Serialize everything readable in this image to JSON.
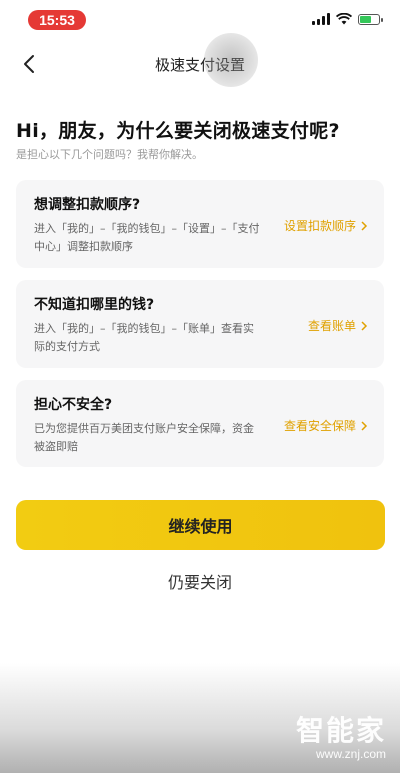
{
  "status_bar": {
    "time": "15:53",
    "battery_level_fraction": 0.55
  },
  "nav": {
    "title": "极速支付设置"
  },
  "headline": "Hi，朋友，为什么要关闭极速支付呢?",
  "subheadline": "是担心以下几个问题吗？我帮你解决。",
  "cards": [
    {
      "title": "想调整扣款顺序?",
      "desc": "进入「我的」–「我的钱包」–「设置」–「支付中心」调整扣款顺序",
      "link": "设置扣款顺序"
    },
    {
      "title": "不知道扣哪里的钱?",
      "desc": "进入「我的」–「我的钱包」–「账单」查看实际的支付方式",
      "link": "查看账单"
    },
    {
      "title": "担心不安全?",
      "desc": "已为您提供百万美团支付账户安全保障，资金被盗即赔",
      "link": "查看安全保障"
    }
  ],
  "primary_button": "继续使用",
  "secondary_button": "仍要关闭",
  "watermark": {
    "logo": "智能家",
    "url": "www.znj.com"
  },
  "colors": {
    "accent": "#f2c811",
    "link": "#e0a100",
    "time_pill": "#e53935"
  }
}
